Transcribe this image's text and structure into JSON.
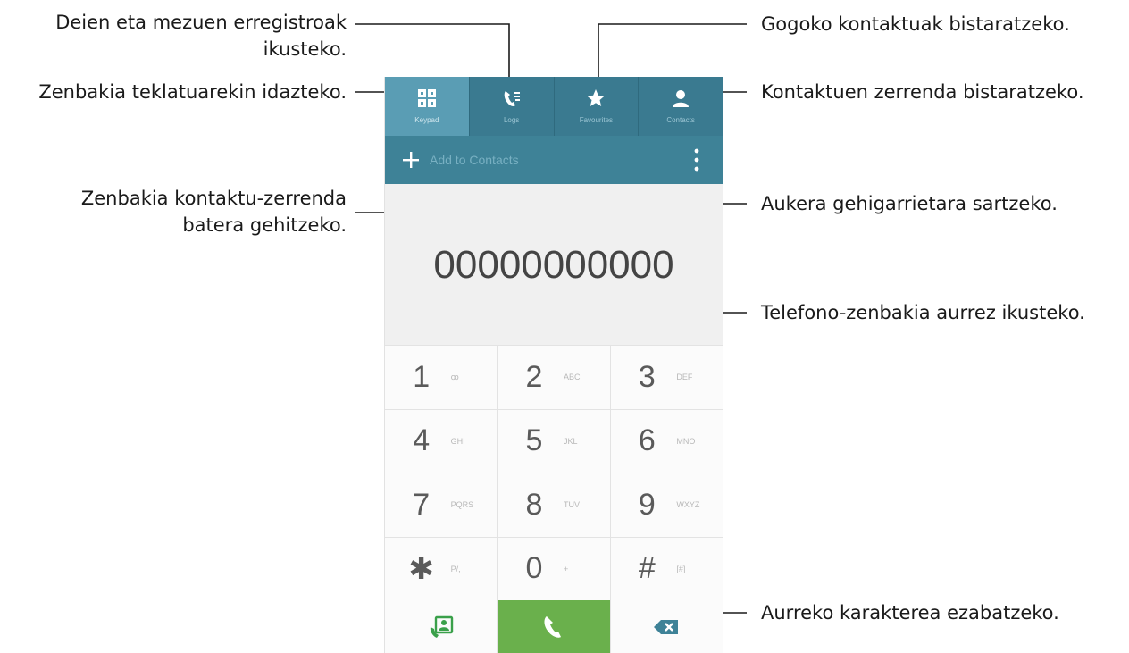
{
  "annotations": {
    "logs_line1": "Deien eta mezuen erregistroak",
    "logs_line2": "ikusteko.",
    "keypad": "Zenbakia teklatuarekin idazteko.",
    "add_line1": "Zenbakia kontaktu-zerrenda",
    "add_line2": "batera gehitzeko.",
    "favourites": "Gogoko kontaktuak bistaratzeko.",
    "contacts": "Kontaktuen zerrenda bistaratzeko.",
    "more_options": "Aukera gehigarrietara sartzeko.",
    "preview": "Telefono-zenbakia aurrez ikusteko.",
    "delete": "Aurreko karakterea ezabatzeko."
  },
  "tabs": [
    {
      "label": "Keypad",
      "icon": "keypad-icon"
    },
    {
      "label": "Logs",
      "icon": "call-log-icon"
    },
    {
      "label": "Favourites",
      "icon": "star-icon"
    },
    {
      "label": "Contacts",
      "icon": "person-icon"
    }
  ],
  "action_bar": {
    "add_label": "Add to Contacts",
    "add_icon": "plus-icon",
    "more_icon": "overflow-menu-icon"
  },
  "number_display": "00000000000",
  "keys": [
    {
      "digit": "1",
      "letters": "ꝏ"
    },
    {
      "digit": "2",
      "letters": "ABC"
    },
    {
      "digit": "3",
      "letters": "DEF"
    },
    {
      "digit": "4",
      "letters": "GHI"
    },
    {
      "digit": "5",
      "letters": "JKL"
    },
    {
      "digit": "6",
      "letters": "MNO"
    },
    {
      "digit": "7",
      "letters": "PQRS"
    },
    {
      "digit": "8",
      "letters": "TUV"
    },
    {
      "digit": "9",
      "letters": "WXYZ"
    },
    {
      "digit": "✱",
      "letters": "P/,"
    },
    {
      "digit": "0",
      "letters": "+"
    },
    {
      "digit": "#",
      "letters": "[#]"
    }
  ],
  "bottom_row": {
    "left_icon": "video-call-icon",
    "call_icon": "phone-icon",
    "delete_icon": "backspace-icon"
  },
  "colors": {
    "tab_bar": "#3a7a90",
    "tab_active": "#5a9db4",
    "call_button": "#6ab04c"
  }
}
